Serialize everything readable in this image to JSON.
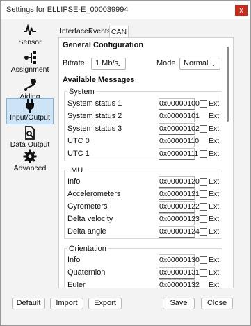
{
  "window": {
    "title": "Settings for ELLIPSE-E_000039994",
    "close_glyph": "x"
  },
  "sidebar": {
    "items": [
      {
        "label": "Sensor",
        "icon": "pulse-icon"
      },
      {
        "label": "Assignment",
        "icon": "hierarchy-icon"
      },
      {
        "label": "Aiding",
        "icon": "route-pin-icon"
      },
      {
        "label": "Input/Output",
        "icon": "plug-icon",
        "active": true
      },
      {
        "label": "Data Output",
        "icon": "document-search-icon"
      },
      {
        "label": "Advanced",
        "icon": "gear-icon"
      }
    ]
  },
  "tabs": [
    {
      "label": "Interfaces"
    },
    {
      "label": "Events"
    },
    {
      "label": "CAN",
      "active": true
    }
  ],
  "general": {
    "heading": "General Configuration",
    "bitrate_label": "Bitrate",
    "bitrate_value": "1 Mb/s",
    "mode_label": "Mode",
    "mode_value": "Normal"
  },
  "messages": {
    "heading": "Available Messages",
    "ext_label": "Ext.",
    "groups": [
      {
        "title": "System",
        "rows": [
          {
            "label": "System status 1",
            "id": "0x00000100"
          },
          {
            "label": "System status 2",
            "id": "0x00000101"
          },
          {
            "label": "System status 3",
            "id": "0x00000102"
          },
          {
            "label": "UTC 0",
            "id": "0x00000110"
          },
          {
            "label": "UTC 1",
            "id": "0x00000111"
          }
        ]
      },
      {
        "title": "IMU",
        "rows": [
          {
            "label": "Info",
            "id": "0x00000120"
          },
          {
            "label": "Accelerometers",
            "id": "0x00000121"
          },
          {
            "label": "Gyrometers",
            "id": "0x00000122"
          },
          {
            "label": "Delta velocity",
            "id": "0x00000123"
          },
          {
            "label": "Delta angle",
            "id": "0x00000124"
          }
        ]
      },
      {
        "title": "Orientation",
        "rows": [
          {
            "label": "Info",
            "id": "0x00000130"
          },
          {
            "label": "Quaternion",
            "id": "0x00000131"
          },
          {
            "label": "Euler",
            "id": "0x00000132"
          }
        ]
      }
    ]
  },
  "footer": {
    "default_label": "Default",
    "import_label": "Import",
    "export_label": "Export",
    "save_label": "Save",
    "close_label": "Close"
  },
  "colors": {
    "close_button": "#c42b1c",
    "active_nav_bg": "#cde4f7",
    "active_nav_border": "#7db3e0"
  }
}
